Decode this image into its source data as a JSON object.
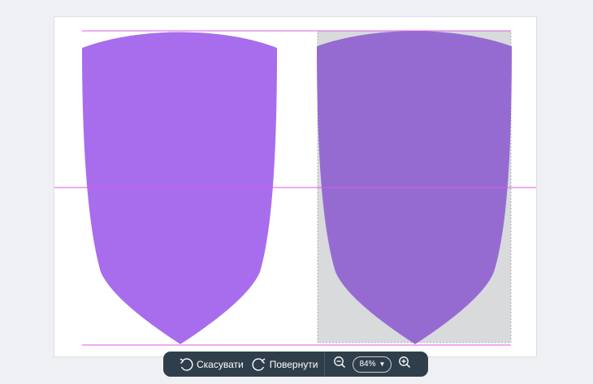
{
  "toolbar": {
    "undo_label": "Скасувати",
    "redo_label": "Повернути",
    "zoom_value": "84%"
  },
  "icons": {
    "undo": "undo-icon",
    "redo": "redo-icon",
    "zoom_out": "zoom-out-icon",
    "zoom_in": "zoom-in-icon",
    "dropdown": "chevron-down-icon"
  },
  "colors": {
    "shield_left": "#a86ded",
    "shield_right": "#966bd1",
    "guide": "#e055e8",
    "selection_bg": "#d8dadc",
    "toolbar_bg": "#2f3e4b",
    "workspace_bg": "#eef0f3"
  }
}
